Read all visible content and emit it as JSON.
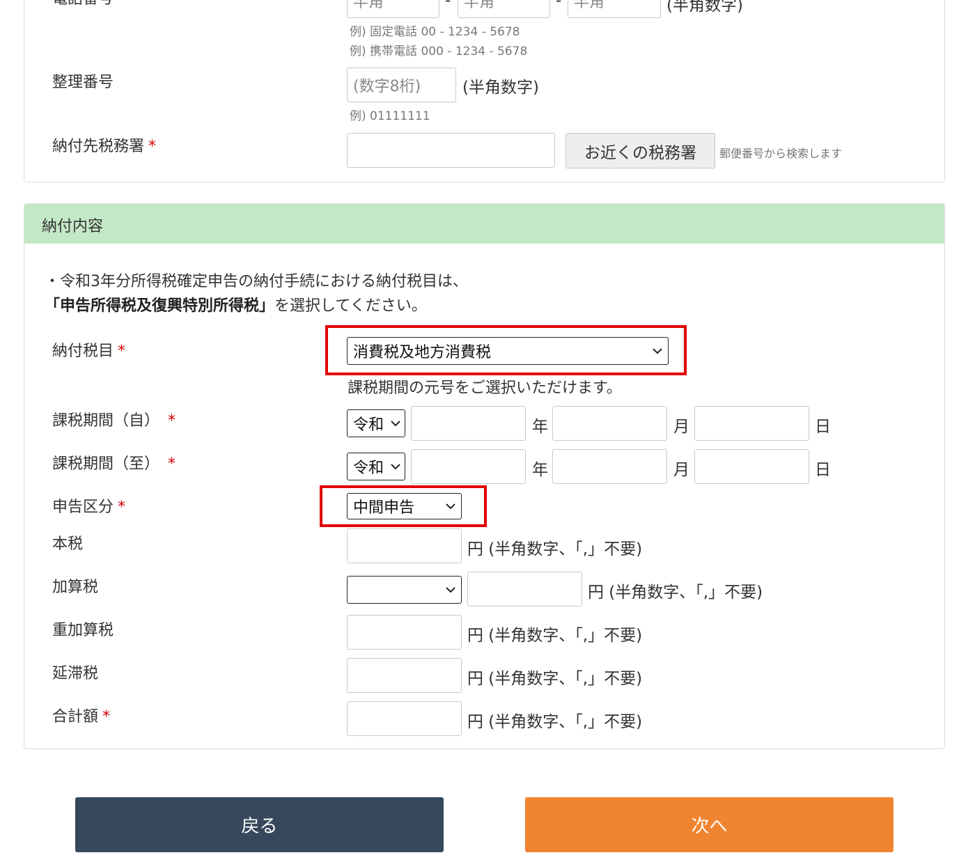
{
  "contact": {
    "phone_label": "電話番号",
    "phone_placeholder": "半角",
    "phone_sep": "-",
    "phone_note": "(半角数字)",
    "phone_ex_fixed": "例) 固定電話 00 - 1234 - 5678",
    "phone_ex_mobile": "例) 携帯電話 000 - 1234 - 5678",
    "ref_label": "整理番号",
    "ref_placeholder": "(数字8桁)",
    "ref_note": "(半角数字)",
    "ref_example": "例) 01111111",
    "office_label": "納付先税務署",
    "office_required": "*",
    "office_value": "",
    "nearby_button": "お近くの税務署",
    "nearby_note": "郵便番号から検索します"
  },
  "payment": {
    "header": "納付内容",
    "notice_line1": "・令和3年分所得税確定申告の納付手続における納付税目は、",
    "notice_bold": "「申告所得税及復興特別所得税」",
    "notice_line2_rest": "を選択してください。",
    "tax_item_label": "納付税目",
    "tax_item_value": "消費税及地方消費税",
    "era_note": "課税期間の元号をご選択いただけます。",
    "period_from_label": "課税期間（自）",
    "period_to_label": "課税期間（至）",
    "era_value": "令和",
    "year_unit": "年",
    "month_unit": "月",
    "day_unit": "日",
    "category_label": "申告区分",
    "category_value": "中間申告",
    "principal_label": "本税",
    "additional_label": "加算税",
    "additional_select_value": "",
    "heavy_label": "重加算税",
    "delinquency_label": "延滞税",
    "total_label": "合計額",
    "amount_note": "円 (半角数字、「,」不要)",
    "required_mark": "*"
  },
  "buttons": {
    "back": "戻る",
    "next": "次へ"
  },
  "colors": {
    "header_bg": "#c3e8c5",
    "back_btn": "#37485c",
    "next_btn": "#f08431",
    "required": "#d60000",
    "highlight": "#e00000"
  }
}
